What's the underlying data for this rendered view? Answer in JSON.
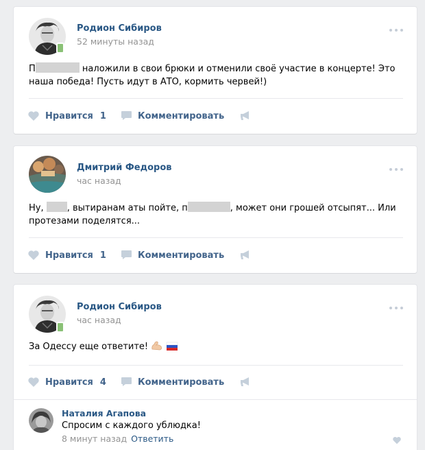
{
  "accent_color": "#2a5885",
  "feed": {
    "posts": [
      {
        "author": "Родион Сибиров",
        "time": "52 минуты назад",
        "text_parts": [
          "П",
          "[redacted]",
          " наложили в свои брюки и отменили своё участие в концерте! Это наша победа! Пусть идут в АТО, кормить червей!)"
        ],
        "like_label": "Нравится",
        "like_count": "1",
        "comment_label": "Комментировать"
      },
      {
        "author": "Дмитрий Федоров",
        "time": "час назад",
        "text_parts": [
          "Ну, ",
          "[redacted]",
          ", вытиранам аты пойте, п",
          "[redacted]",
          ", может они грошей отсыпят... Или протезами поделятся..."
        ],
        "like_label": "Нравится",
        "like_count": "1",
        "comment_label": "Комментировать"
      },
      {
        "author": "Родион Сибиров",
        "time": "час назад",
        "text": "За Одессу еще ответите!",
        "emojis": [
          "flexed-biceps-emoji",
          "russian-flag-emoji"
        ],
        "like_label": "Нравится",
        "like_count": "4",
        "comment_label": "Комментировать",
        "comment": {
          "author": "Наталия Агапова",
          "text": "Спросим с каждого ублюдка!",
          "time": "8 минут назад",
          "reply_label": "Ответить"
        }
      }
    ]
  },
  "icons": [
    "heart-icon",
    "comment-icon",
    "share-megaphone-icon",
    "more-dots-icon",
    "online-mobile-icon"
  ]
}
